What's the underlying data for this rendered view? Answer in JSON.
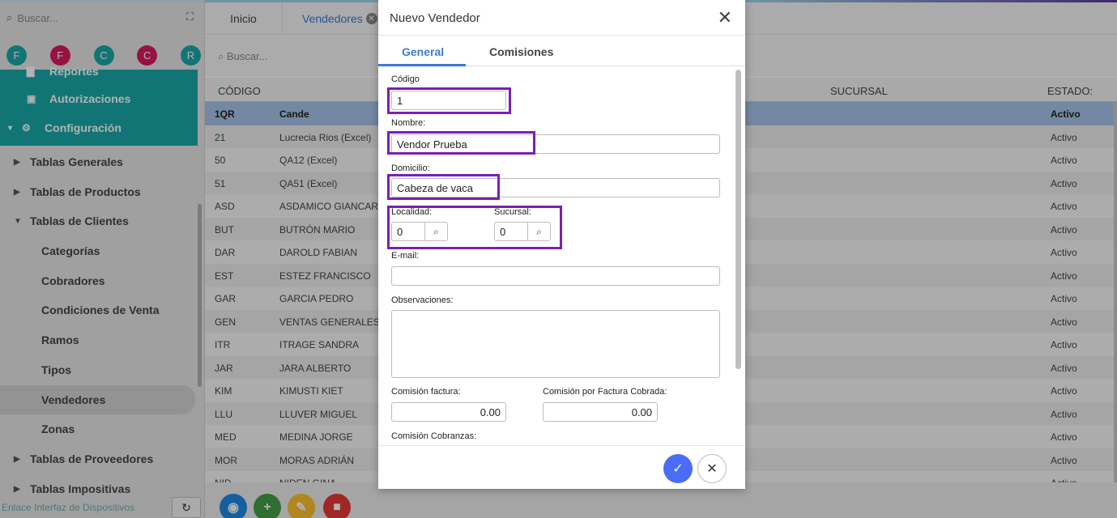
{
  "sidebar": {
    "search_placeholder": "Buscar...",
    "favorites": [
      {
        "letter": "F",
        "color": "#1ba8a8"
      },
      {
        "letter": "F",
        "color": "#d81b60"
      },
      {
        "letter": "C",
        "color": "#1ba8a8"
      },
      {
        "letter": "C",
        "color": "#d81b60"
      },
      {
        "letter": "R",
        "color": "#1ba8a8"
      }
    ],
    "reportes": "Reportes",
    "autorizaciones": "Autorizaciones",
    "configuracion": "Configuración",
    "items": [
      "Tablas Generales",
      "Tablas de Productos",
      "Tablas de Clientes",
      "Categorías",
      "Cobradores",
      "Condiciones de Venta",
      "Ramos",
      "Tipos",
      "Vendedores",
      "Zonas",
      "Tablas de Proveedores",
      "Tablas Impositivas"
    ],
    "footer_link": "Enlace Interfaz de Dispositivos"
  },
  "tabs": {
    "inicio": "Inicio",
    "vendedores": "Vendedores"
  },
  "search": {
    "placeholder": "Buscar..."
  },
  "grid": {
    "headers": {
      "codigo": "CÓDIGO",
      "sucursal": "SUCURSAL",
      "estado": "ESTADO:"
    },
    "rows": [
      {
        "code": "1QR",
        "name": "Cande",
        "estado": "Activo"
      },
      {
        "code": "21",
        "name": "Lucrecia Rios (Excel)",
        "estado": "Activo"
      },
      {
        "code": "50",
        "name": "QA12 (Excel)",
        "estado": "Activo"
      },
      {
        "code": "51",
        "name": "QA51 (Excel)",
        "estado": "Activo"
      },
      {
        "code": "ASD",
        "name": "ASDAMICO GIANCARLO",
        "estado": "Activo"
      },
      {
        "code": "BUT",
        "name": "BUTRÓN MARIO",
        "estado": "Activo"
      },
      {
        "code": "DAR",
        "name": "DAROLD FABIAN",
        "estado": "Activo"
      },
      {
        "code": "EST",
        "name": "ESTEZ FRANCISCO",
        "estado": "Activo"
      },
      {
        "code": "GAR",
        "name": "GARCIA PEDRO",
        "estado": "Activo"
      },
      {
        "code": "GEN",
        "name": "VENTAS GENERALES",
        "estado": "Activo"
      },
      {
        "code": "ITR",
        "name": "ITRAGE SANDRA",
        "estado": "Activo"
      },
      {
        "code": "JAR",
        "name": "JARA ALBERTO",
        "estado": "Activo"
      },
      {
        "code": "KIM",
        "name": "KIMUSTI KIET",
        "estado": "Activo"
      },
      {
        "code": "LLU",
        "name": "LLUVER MIGUEL",
        "estado": "Activo"
      },
      {
        "code": "MED",
        "name": "MEDINA JORGE",
        "estado": "Activo"
      },
      {
        "code": "MOR",
        "name": "MORAS ADRIÁN",
        "estado": "Activo"
      },
      {
        "code": "NID",
        "name": "NIDEN GINA",
        "estado": "Activo"
      }
    ]
  },
  "fabs": [
    {
      "icon": "eye-icon",
      "glyph": "◉",
      "color": "#1e88e5"
    },
    {
      "icon": "plus-icon",
      "glyph": "+",
      "color": "#43a047"
    },
    {
      "icon": "pencil-icon",
      "glyph": "✎",
      "color": "#fbc02d"
    },
    {
      "icon": "trash-icon",
      "glyph": "■",
      "color": "#e53935"
    }
  ],
  "modal": {
    "title": "Nuevo Vendedor",
    "tab_general": "General",
    "tab_comisiones": "Comisiones",
    "codigo_label": "Código",
    "codigo_value": "1",
    "nombre_label": "Nombre:",
    "nombre_value": "Vendor Prueba",
    "domicilio_label": "Domicilio:",
    "domicilio_value": "Cabeza de vaca",
    "localidad_label": "Localidad:",
    "localidad_value": "0",
    "sucursal_label": "Sucursal:",
    "sucursal_value": "0",
    "email_label": "E-mail:",
    "email_value": "",
    "observaciones_label": "Observaciones:",
    "observaciones_value": "",
    "comision_factura_label": "Comisión factura:",
    "comision_factura_value": "0.00",
    "comision_cobrada_label": "Comisión por Factura Cobrada:",
    "comision_cobrada_value": "0.00",
    "comision_cobranzas_label": "Comisión Cobranzas:"
  },
  "colors": {
    "teal": "#1ba8a8",
    "accent_blue": "#3a7bd5",
    "highlight_purple": "#7a1fb5",
    "selected_row": "#a6c3ea"
  }
}
